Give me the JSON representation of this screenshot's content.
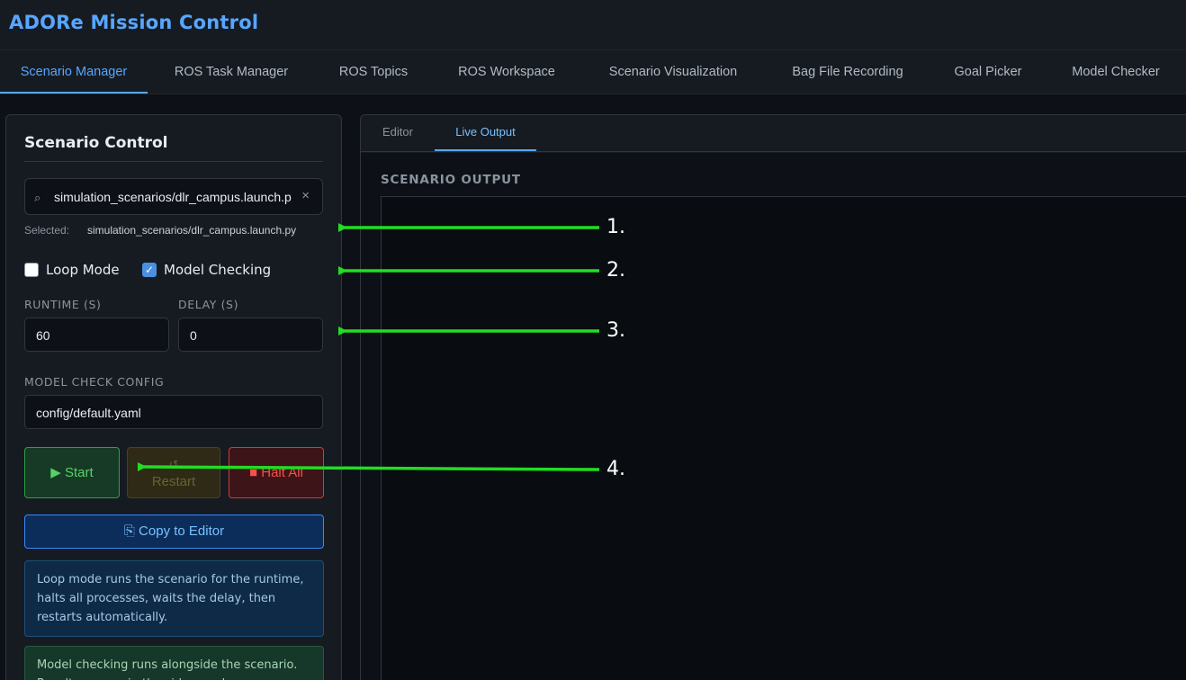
{
  "app": {
    "title": "ADORe Mission Control"
  },
  "nav": {
    "tabs": [
      {
        "label": "Scenario Manager",
        "active": true
      },
      {
        "label": "ROS Task Manager"
      },
      {
        "label": "ROS Topics"
      },
      {
        "label": "ROS Workspace"
      },
      {
        "label": "Scenario Visualization"
      },
      {
        "label": "Bag File Recording"
      },
      {
        "label": "Goal Picker"
      },
      {
        "label": "Model Checker"
      }
    ]
  },
  "scenario_control": {
    "title": "Scenario Control",
    "search_value": "simulation_scenarios/dlr_campus.launch.py",
    "search_icon": "search-icon",
    "clear_icon": "close-icon",
    "clear_glyph": "×",
    "search_glyph": "⌕",
    "selected_label": "Selected:",
    "selected_value": "simulation_scenarios/dlr_campus.launch.py",
    "loop_mode": {
      "label": "Loop Mode",
      "checked": false
    },
    "model_checking": {
      "label": "Model Checking",
      "checked": true,
      "glyph": "✓"
    },
    "runtime": {
      "label": "RUNTIME (S)",
      "value": "60"
    },
    "delay": {
      "label": "DELAY (S)",
      "value": "0"
    },
    "model_check_config": {
      "label": "MODEL CHECK CONFIG",
      "value": "config/default.yaml"
    },
    "buttons": {
      "start": "▶ Start",
      "restart_glyph": "↺",
      "restart": "Restart",
      "halt": "■ Halt All",
      "copy": "⎘ Copy to Editor"
    },
    "info_loop": "Loop mode runs the scenario for the runtime, halts all processes, waits the delay, then restarts automatically.",
    "info_model": "Model checking runs alongside the scenario. Results appear in the side panel."
  },
  "output_panel": {
    "tabs": [
      {
        "label": "Editor"
      },
      {
        "label": "Live Output",
        "active": true
      }
    ],
    "title": "SCENARIO OUTPUT"
  },
  "annotations": {
    "color": "#22dd22",
    "labels": [
      "1.",
      "2.",
      "3.",
      "4."
    ]
  }
}
